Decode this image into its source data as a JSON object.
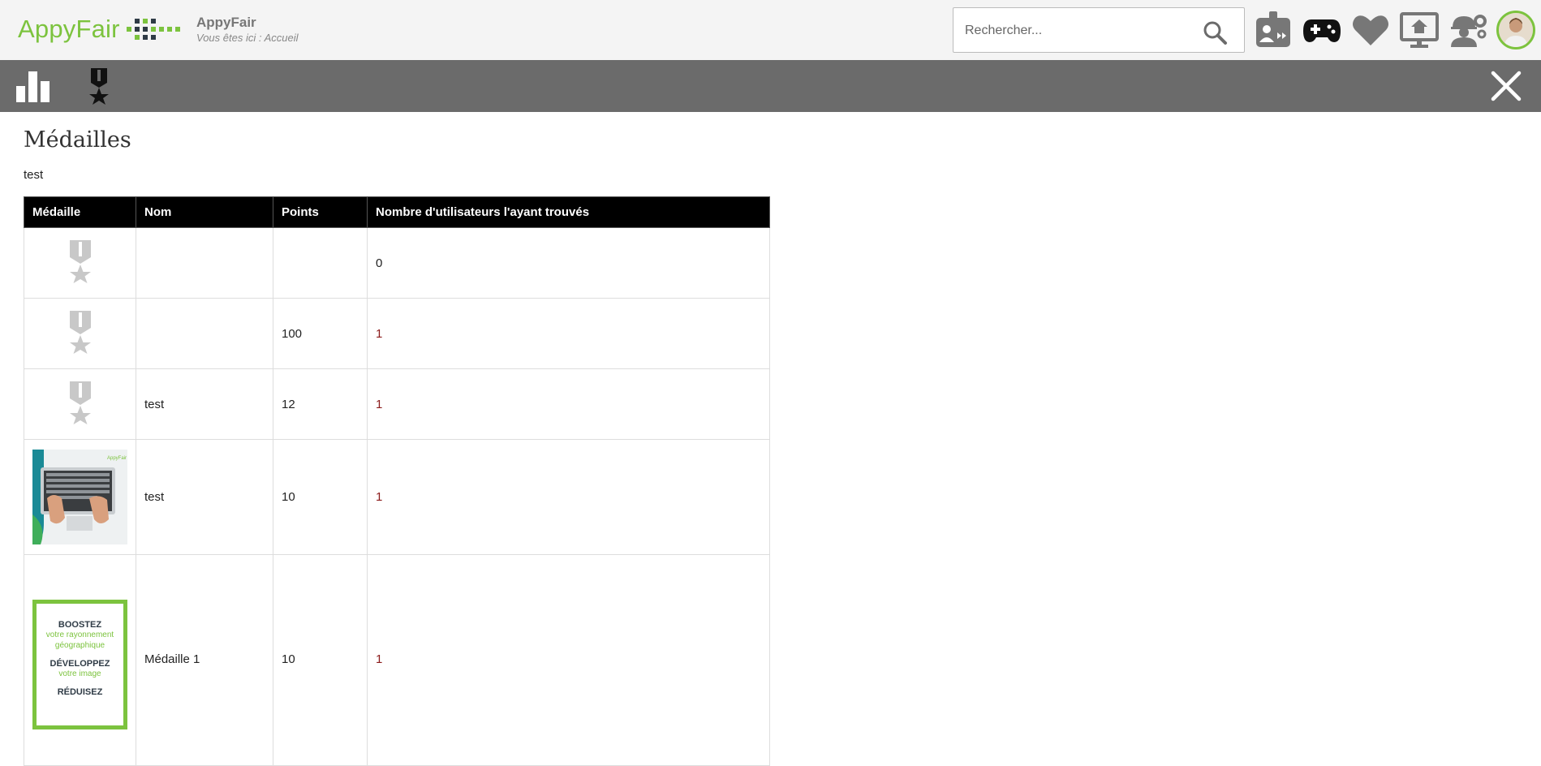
{
  "header": {
    "logo_text": "AppyFair",
    "app_title": "AppyFair",
    "breadcrumb": "Vous êtes ici : Accueil",
    "search_placeholder": "Rechercher...",
    "icons": [
      "badge-icon",
      "gamepad-icon",
      "heart-icon",
      "monitor-home-icon",
      "worker-settings-icon"
    ],
    "accent_color": "#7cc33e"
  },
  "toolbar": {
    "icons": [
      "bar-chart-icon",
      "medal-icon",
      "close-icon"
    ],
    "background": "#6b6b6b"
  },
  "main": {
    "title": "Médailles",
    "subtitle": "test",
    "table": {
      "columns": [
        "Médaille",
        "Nom",
        "Points",
        "Nombre d'utilisateurs l'ayant trouvés"
      ],
      "rows": [
        {
          "image": "medal-placeholder",
          "name": "",
          "points": "",
          "users": "0"
        },
        {
          "image": "medal-placeholder",
          "name": "",
          "points": "100",
          "users": "1"
        },
        {
          "image": "medal-placeholder",
          "name": "test",
          "points": "12",
          "users": "1"
        },
        {
          "image": "laptop-photo",
          "name": "test",
          "points": "10",
          "users": "1"
        },
        {
          "image": "poster",
          "name": "Médaille 1",
          "points": "10",
          "users": "1",
          "poster_text": [
            "BOOSTEZ",
            "votre rayonnement",
            "géographique",
            "DÉVELOPPEZ",
            "votre image",
            "RÉDUISEZ"
          ]
        }
      ]
    }
  }
}
